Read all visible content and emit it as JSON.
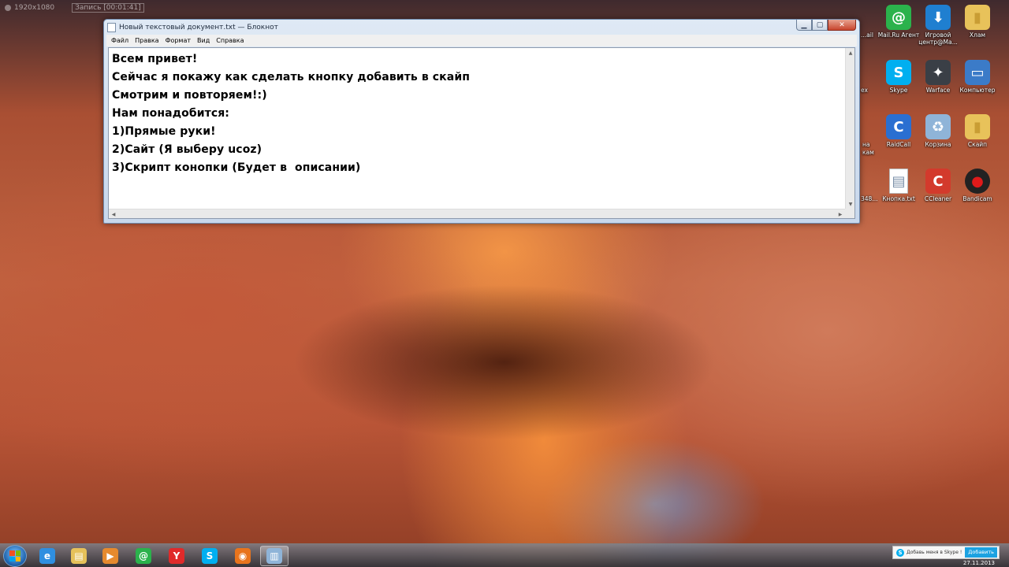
{
  "overlay": {
    "resolution": "1920x1080",
    "recording": "Запись [00:01:41]"
  },
  "window": {
    "title": "Новый текстовый документ.txt — Блокнот",
    "menu": [
      "Файл",
      "Правка",
      "Формат",
      "Вид",
      "Справка"
    ],
    "lines": [
      "Всем привет!",
      "Сейчас я покажу как сделать кнопку добавить в скайп",
      "Смотрим и повторяем!:)",
      "Нам понадобится:",
      "1)Прямые руки!",
      "2)Сайт (Я выберу ucoz)",
      "3)Скрипт конопки (Будет в  описании)"
    ]
  },
  "desktop_icons": [
    {
      "label": "Mail.Ru Агент",
      "icon": "mail-agent-icon",
      "color": "#2bb24c"
    },
    {
      "label": "Игровой центр@Ma...",
      "icon": "game-center-icon",
      "color": "#1f7fd0"
    },
    {
      "label": "Хлам",
      "icon": "folder-icon",
      "color": "#e8c25a"
    },
    {
      "label": "Skype",
      "icon": "skype-icon",
      "color": "#00aff0"
    },
    {
      "label": "Warface",
      "icon": "warface-icon",
      "color": "#3a3f46"
    },
    {
      "label": "Компьютер",
      "icon": "computer-icon",
      "color": "#3b7bc8"
    },
    {
      "label": "RaidCall",
      "icon": "raidcall-icon",
      "color": "#2a6fd1"
    },
    {
      "label": "Корзина",
      "icon": "recycle-bin-icon",
      "color": "#8fb4d8"
    },
    {
      "label": "Скайп",
      "icon": "folder-icon",
      "color": "#e8c25a"
    },
    {
      "label": "Кнопка.txt",
      "icon": "text-file-icon",
      "color": "#ffffff"
    },
    {
      "label": "CCleaner",
      "icon": "ccleaner-icon",
      "color": "#d33a2c"
    },
    {
      "label": "Bandicam",
      "icon": "bandicam-icon",
      "color": "#222222"
    }
  ],
  "partial_labels": [
    "...ail",
    "ex",
    "на",
    "кам",
    "348..."
  ],
  "taskbar": {
    "items": [
      {
        "name": "internet-explorer-icon",
        "glyph": "e",
        "color": "#2f8fe0"
      },
      {
        "name": "explorer-icon",
        "glyph": "▤",
        "color": "#e6c15a"
      },
      {
        "name": "media-player-icon",
        "glyph": "▶",
        "color": "#e68a2e"
      },
      {
        "name": "mail-agent-icon",
        "glyph": "@",
        "color": "#2bb24c"
      },
      {
        "name": "yandex-browser-icon",
        "glyph": "Y",
        "color": "#e02a2a"
      },
      {
        "name": "skype-icon",
        "glyph": "S",
        "color": "#00aff0"
      },
      {
        "name": "firefox-icon",
        "glyph": "◉",
        "color": "#e8741d"
      },
      {
        "name": "notepad-icon",
        "glyph": "▥",
        "color": "#8fb4d8"
      }
    ]
  },
  "notification": {
    "text": "Добавь меня в Skype !",
    "button": "Добавить"
  },
  "clock": {
    "date": "27.11.2013"
  }
}
